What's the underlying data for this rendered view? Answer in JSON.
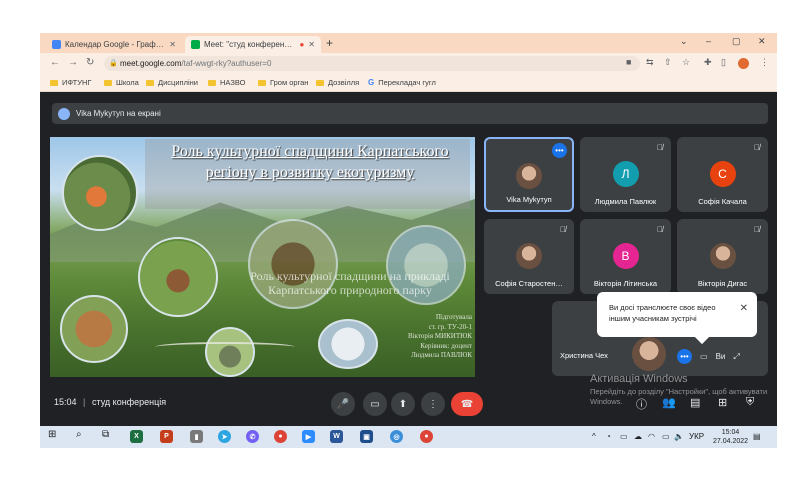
{
  "browser": {
    "tabs": [
      {
        "label": "Календар Google - Графік почи",
        "active": false
      },
      {
        "label": "Meet: \"студ конференція\"",
        "active": true
      }
    ],
    "new_tab": "+",
    "window_controls": {
      "chevron": "⌄",
      "minimize": "–",
      "restore": "▢",
      "close": "✕"
    },
    "url_host": "meet.google.com",
    "url_path": "/taf-wwgt-rky?authuser=0",
    "bookmarks": [
      "ИФТУНГ",
      "Школа",
      "Дисципліни",
      "НАЗВО",
      "Гром орган",
      "Дозвілля",
      "Перекладач гугл"
    ]
  },
  "meet": {
    "presenting_banner": "Vika Mykутуп на екрані",
    "slide": {
      "title": "Роль культурної спадщини Карпатського регіону в розвитку екотуризму",
      "subtitle": "Роль культурної спадщини на прикладі Карпатського природного парку",
      "author_lines": [
        "Підготувала",
        "ст. гр. ТУ-20-1",
        "Вікторія МИКИТЮК",
        "Керівник: доцент",
        "Людмила ПАВЛЮК"
      ]
    },
    "participants": [
      {
        "name": "Vika Mykутуп",
        "initial": "",
        "color": "",
        "muted": false,
        "photo": true
      },
      {
        "name": "Людмила Павлюк",
        "initial": "Л",
        "color": "#129eaf",
        "muted": true,
        "photo": false
      },
      {
        "name": "Софія Качала",
        "initial": "С",
        "color": "#e8430e",
        "muted": true,
        "photo": false
      },
      {
        "name": "Софія Старостен…",
        "initial": "",
        "color": "",
        "muted": true,
        "photo": true
      },
      {
        "name": "Вікторія Літинська",
        "initial": "В",
        "color": "#e52592",
        "muted": true,
        "photo": false
      },
      {
        "name": "Вікторія Дигас",
        "initial": "",
        "color": "",
        "muted": true,
        "photo": true
      },
      {
        "name": "Христина Чех",
        "initial": "",
        "color": "",
        "muted": false,
        "photo": true
      }
    ],
    "bubble_text": "Ви досі транслюєте своє відео іншим учасникам зустрічі",
    "self_label": "Ви",
    "time": "15:04",
    "meeting_name": "студ конференція"
  },
  "activation": {
    "title": "Активація Windows",
    "body": "Перейдіть до розділу \"Настройки\", щоб активувати Windows."
  },
  "taskbar": {
    "language": "УКР",
    "time": "15:04",
    "date": "27.04.2022"
  },
  "colors": {
    "accent": "#1a73e8",
    "end_call": "#ea4335",
    "tab_strip": "#fad9c2"
  }
}
